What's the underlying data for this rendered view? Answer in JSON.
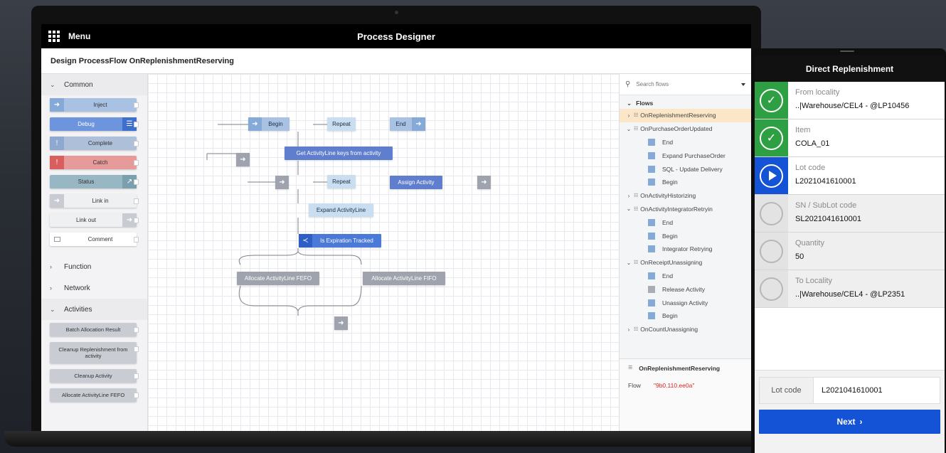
{
  "designer": {
    "menu_label": "Menu",
    "app_title": "Process Designer",
    "page_title": "Design ProcessFlow OnReplenishmentReserving",
    "accent_color": "#5f7fce"
  },
  "palette": {
    "common_label": "Common",
    "common_items": [
      {
        "label": "Inject",
        "icon": "arrow-right-icon"
      },
      {
        "label": "Debug",
        "icon": "menu-lines-icon"
      },
      {
        "label": "Complete",
        "icon": "exclamation-icon"
      },
      {
        "label": "Catch",
        "icon": "exclamation-icon"
      },
      {
        "label": "Status",
        "icon": "trend-icon"
      },
      {
        "label": "Link in",
        "icon": "arrow-right-icon"
      },
      {
        "label": "Link out",
        "icon": "arrow-right-icon"
      },
      {
        "label": "Comment",
        "icon": "comment-icon"
      }
    ],
    "function_label": "Function",
    "network_label": "Network",
    "activities_label": "Activities",
    "activity_items": [
      "Batch Allocation Result",
      "Cleanup Replenishment from activity",
      "Cleanup Activity",
      "Allocate ActivityLine FEFO"
    ]
  },
  "canvas": {
    "nodes": {
      "begin": "Begin",
      "repeat1": "Repeat",
      "end": "End",
      "get_keys": "Get ActivityLine keys from activity",
      "repeat2": "Repeat",
      "assign": "Assign Activity",
      "expand": "Expand ActivityLine",
      "tracked": "Is Expiration Tracked",
      "fefo": "Allocate ActivityLine FEFO",
      "fifo": "Allocate ActivityLine FIFO"
    }
  },
  "flows_panel": {
    "search_placeholder": "Search flows",
    "flows_label": "Flows",
    "tree": [
      {
        "label": "OnReplenishmentReserving",
        "level": 0,
        "expanded": false,
        "selected": true
      },
      {
        "label": "OnPurchaseOrderUpdated",
        "level": 0,
        "expanded": true
      },
      {
        "label": "End",
        "level": 1,
        "kind": "blue"
      },
      {
        "label": "Expand PurchaseOrder",
        "level": 1,
        "kind": "blue"
      },
      {
        "label": "SQL - Update Delivery",
        "level": 1,
        "kind": "blue"
      },
      {
        "label": "Begin",
        "level": 1,
        "kind": "blue"
      },
      {
        "label": "OnActivityHistorizing",
        "level": 0,
        "expanded": false
      },
      {
        "label": "OnActivityIntegratorRetryin",
        "level": 0,
        "expanded": true
      },
      {
        "label": "End",
        "level": 1,
        "kind": "blue"
      },
      {
        "label": "Begin",
        "level": 1,
        "kind": "blue"
      },
      {
        "label": "Integrator Retrying",
        "level": 1,
        "kind": "blue"
      },
      {
        "label": "OnReceiptUnassigning",
        "level": 0,
        "expanded": true
      },
      {
        "label": "End",
        "level": 1,
        "kind": "blue"
      },
      {
        "label": "Release Activity",
        "level": 1,
        "kind": "gray"
      },
      {
        "label": "Unassign Activity",
        "level": 1,
        "kind": "blue"
      },
      {
        "label": "Begin",
        "level": 1,
        "kind": "blue"
      },
      {
        "label": "OnCountUnassigning",
        "level": 0,
        "expanded": false
      }
    ],
    "props_title": "OnReplenishmentReserving",
    "props_key": "Flow",
    "props_value": "\"9b0.110.ee0a\""
  },
  "handheld": {
    "title": "Direct Replenishment",
    "steps": [
      {
        "label": "From locality",
        "value": "..|Warehouse/CEL4 - @LP10456",
        "state": "done"
      },
      {
        "label": "Item",
        "value": "COLA_01",
        "state": "done"
      },
      {
        "label": "Lot code",
        "value": "L2021041610001",
        "state": "current"
      },
      {
        "label": "SN / SubLot code",
        "value": "SL2021041610001",
        "state": "todo"
      },
      {
        "label": "Quantity",
        "value": "50",
        "state": "todo"
      },
      {
        "label": "To Locality",
        "value": "..|Warehouse/CEL4 - @LP2351",
        "state": "todo"
      }
    ],
    "input_label": "Lot code",
    "input_value": "L2021041610001",
    "next_label": "Next",
    "done_color": "#2ea043",
    "current_color": "#1553d6"
  }
}
